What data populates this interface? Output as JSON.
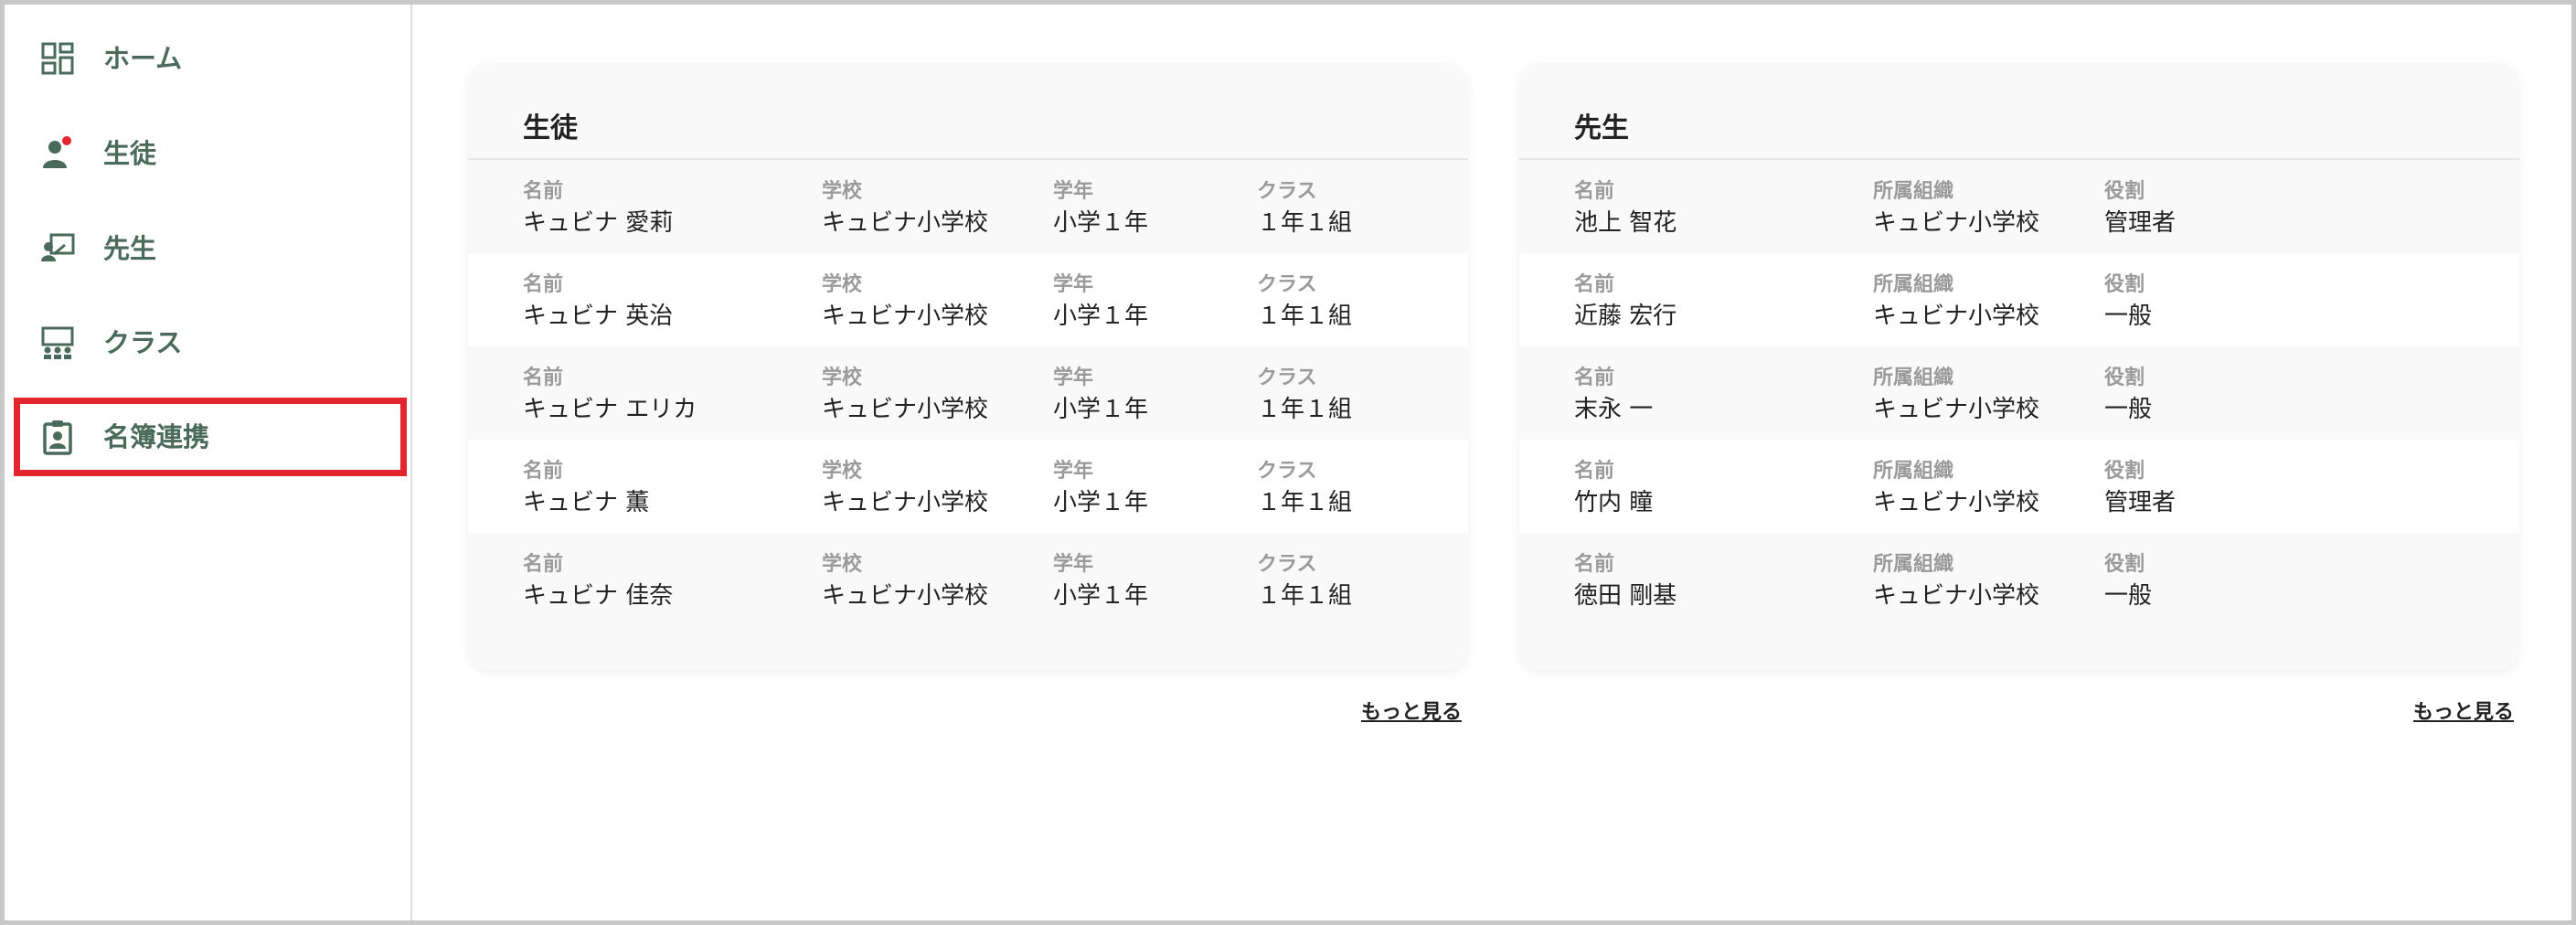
{
  "sidebar": {
    "items": [
      {
        "label": "ホーム",
        "icon": "dashboard-icon"
      },
      {
        "label": "生徒",
        "icon": "student-icon",
        "badge_color": "#e3262e"
      },
      {
        "label": "先生",
        "icon": "teacher-icon"
      },
      {
        "label": "クラス",
        "icon": "class-icon"
      },
      {
        "label": "名簿連携",
        "icon": "roster-badge-icon",
        "highlight_color": "#e3262e"
      }
    ]
  },
  "students": {
    "title": "生徒",
    "headers": [
      "名前",
      "学校",
      "学年",
      "クラス"
    ],
    "rows": [
      [
        "キュビナ 愛莉",
        "キュビナ小学校",
        "小学１年",
        "１年１組"
      ],
      [
        "キュビナ 英治",
        "キュビナ小学校",
        "小学１年",
        "１年１組"
      ],
      [
        "キュビナ エリカ",
        "キュビナ小学校",
        "小学１年",
        "１年１組"
      ],
      [
        "キュビナ 薫",
        "キュビナ小学校",
        "小学１年",
        "１年１組"
      ],
      [
        "キュビナ 佳奈",
        "キュビナ小学校",
        "小学１年",
        "１年１組"
      ]
    ],
    "more_label": "もっと見る"
  },
  "teachers": {
    "title": "先生",
    "headers": [
      "名前",
      "所属組織",
      "役割"
    ],
    "rows": [
      [
        "池上 智花",
        "キュビナ小学校",
        "管理者"
      ],
      [
        "近藤 宏行",
        "キュビナ小学校",
        "一般"
      ],
      [
        "末永 一",
        "キュビナ小学校",
        "一般"
      ],
      [
        "竹内 瞳",
        "キュビナ小学校",
        "管理者"
      ],
      [
        "徳田 剛基",
        "キュビナ小学校",
        "一般"
      ]
    ],
    "more_label": "もっと見る"
  },
  "colors": {
    "accent": "#4a6a5c",
    "highlight": "#e3262e"
  }
}
